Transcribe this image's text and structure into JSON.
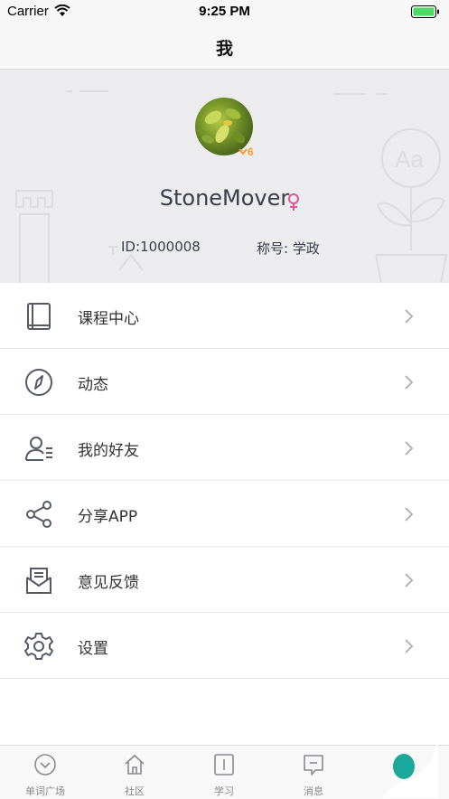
{
  "status_bar": {
    "carrier": "Carrier",
    "time": "9:25 PM"
  },
  "nav": {
    "title": "我"
  },
  "profile": {
    "username": "StoneMover",
    "level": "6",
    "id_text": "ID:1000008",
    "title_text": "称号: 学政",
    "gender": "female",
    "gender_color": "#e0559a"
  },
  "menu": [
    {
      "label": "课程中心",
      "icon": "book-icon"
    },
    {
      "label": "动态",
      "icon": "compass-icon"
    },
    {
      "label": "我的好友",
      "icon": "friends-icon"
    },
    {
      "label": "分享APP",
      "icon": "share-icon"
    },
    {
      "label": "意见反馈",
      "icon": "feedback-mail-icon"
    },
    {
      "label": "设置",
      "icon": "settings-gear-icon"
    }
  ],
  "tabs": [
    {
      "label": "单词广场",
      "icon": "chevron-circle-icon"
    },
    {
      "label": "社区",
      "icon": "house-icon"
    },
    {
      "label": "学习",
      "icon": "book-box-icon"
    },
    {
      "label": "消息",
      "icon": "message-icon"
    }
  ],
  "colors": {
    "accent": "#1aa89a",
    "battery": "#4cd964",
    "badge": "#f0a030",
    "text_dark": "#3a3d4a"
  }
}
